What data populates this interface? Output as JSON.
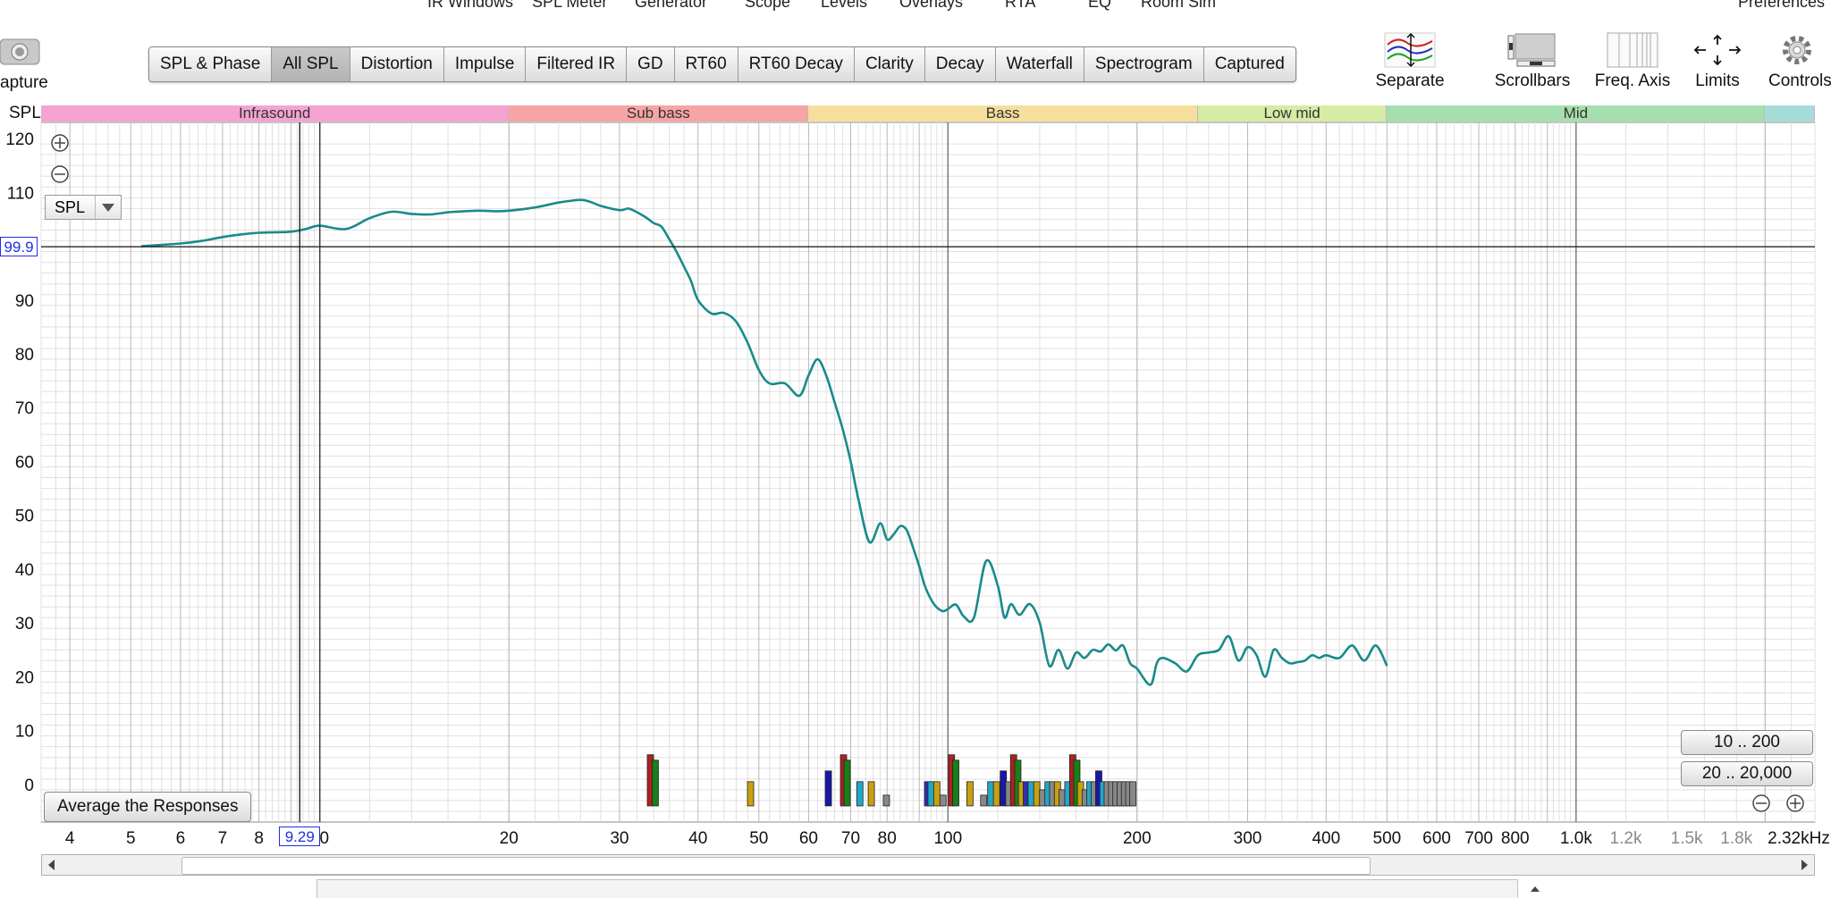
{
  "menu": {
    "items": [
      "IR Windows",
      "SPL Meter",
      "Generator",
      "Scope",
      "Levels",
      "Overlays",
      "RTA",
      "EQ",
      "Room Sim",
      "Preferences"
    ]
  },
  "capture": {
    "label": "apture"
  },
  "tabs": [
    {
      "label": "SPL & Phase",
      "active": false
    },
    {
      "label": "All SPL",
      "active": true
    },
    {
      "label": "Distortion",
      "active": false
    },
    {
      "label": "Impulse",
      "active": false
    },
    {
      "label": "Filtered IR",
      "active": false
    },
    {
      "label": "GD",
      "active": false
    },
    {
      "label": "RT60",
      "active": false
    },
    {
      "label": "RT60 Decay",
      "active": false
    },
    {
      "label": "Clarity",
      "active": false
    },
    {
      "label": "Decay",
      "active": false
    },
    {
      "label": "Waterfall",
      "active": false
    },
    {
      "label": "Spectrogram",
      "active": false
    },
    {
      "label": "Captured",
      "active": false
    }
  ],
  "toolbar": {
    "separate_label": "Separate",
    "scrollbars_label": "Scrollbars",
    "freq_axis_label": "Freq. Axis",
    "limits_label": "Limits",
    "controls_label": "Controls"
  },
  "graph": {
    "y_axis_title": "SPL",
    "selector_value": "SPL",
    "average_button_label": "Average the Responses",
    "range_buttons": [
      "10 .. 200",
      "20 .. 20,000"
    ],
    "cursor_y_readout": "99.9",
    "cursor_x_readout": "9.29",
    "bands": [
      {
        "label": "Infrasound",
        "from": 3.6,
        "to": 20,
        "color": "#f4a3d2"
      },
      {
        "label": "Sub bass",
        "from": 20,
        "to": 60,
        "color": "#f6a4a4"
      },
      {
        "label": "Bass",
        "from": 60,
        "to": 250,
        "color": "#f6df9c"
      },
      {
        "label": "Low mid",
        "from": 250,
        "to": 500,
        "color": "#d6eba3"
      },
      {
        "label": "Mid",
        "from": 500,
        "to": 2000,
        "color": "#a6dfae"
      },
      {
        "label": "",
        "from": 2000,
        "to": 2400,
        "color": "#a6dcd8"
      }
    ],
    "x_tick_labels": [
      {
        "f": 4,
        "text": "4"
      },
      {
        "f": 5,
        "text": "5"
      },
      {
        "f": 6,
        "text": "6"
      },
      {
        "f": 7,
        "text": "7"
      },
      {
        "f": 8,
        "text": "8"
      },
      {
        "f": 10,
        "text": "0"
      },
      {
        "f": 20,
        "text": "20"
      },
      {
        "f": 30,
        "text": "30"
      },
      {
        "f": 40,
        "text": "40"
      },
      {
        "f": 50,
        "text": "50"
      },
      {
        "f": 60,
        "text": "60"
      },
      {
        "f": 70,
        "text": "70"
      },
      {
        "f": 80,
        "text": "80"
      },
      {
        "f": 100,
        "text": "100"
      },
      {
        "f": 200,
        "text": "200"
      },
      {
        "f": 300,
        "text": "300"
      },
      {
        "f": 400,
        "text": "400"
      },
      {
        "f": 500,
        "text": "500"
      },
      {
        "f": 600,
        "text": "600"
      },
      {
        "f": 700,
        "text": "700"
      },
      {
        "f": 800,
        "text": "800"
      },
      {
        "f": 1000,
        "text": "1.0k"
      },
      {
        "f": 1200,
        "text": "1.2k",
        "grey": true
      },
      {
        "f": 1500,
        "text": "1.5k",
        "grey": true
      },
      {
        "f": 1800,
        "text": "1.8k",
        "grey": true
      },
      {
        "f": 2320,
        "text": "2.32kHz"
      }
    ],
    "y_tick_labels": [
      "120",
      "110",
      "90",
      "80",
      "70",
      "60",
      "50",
      "40",
      "30",
      "20",
      "10",
      "0"
    ]
  },
  "chart_data": {
    "type": "line",
    "xscale": "log",
    "xlim": [
      3.6,
      2400
    ],
    "ylim": [
      -7,
      123
    ],
    "ylabel": "SPL",
    "grid": true,
    "cursor": {
      "x": 9.29,
      "y": 99.9
    },
    "series": [
      {
        "color": "#1a8a8a",
        "x": [
          5.2,
          6,
          6.5,
          7,
          7.5,
          8,
          8.5,
          9,
          9.5,
          10,
          11,
          12,
          13,
          14,
          15,
          16,
          17,
          18,
          19,
          20,
          22,
          24,
          26,
          27,
          28,
          30,
          31,
          32,
          33,
          34,
          35,
          36,
          37,
          38,
          39,
          40,
          42,
          44,
          46,
          48,
          50,
          52,
          55,
          58,
          60,
          62,
          64,
          66,
          68,
          70,
          72,
          75,
          78,
          80,
          82,
          84,
          86,
          88,
          90,
          92,
          95,
          98,
          100,
          103,
          106,
          110,
          115,
          120,
          123,
          126,
          130,
          135,
          140,
          145,
          150,
          155,
          160,
          165,
          170,
          175,
          180,
          185,
          190,
          195,
          200,
          210,
          215,
          220,
          230,
          240,
          250,
          260,
          270,
          280,
          290,
          300,
          310,
          320,
          330,
          340,
          350,
          360,
          370,
          380,
          390,
          400,
          420,
          440,
          460,
          480,
          500
        ],
        "y": [
          100,
          100.5,
          101,
          101.7,
          102.2,
          102.5,
          102.6,
          102.7,
          103.2,
          103.8,
          103.2,
          105.2,
          106.4,
          106,
          105.9,
          106.3,
          106.5,
          106.6,
          106.5,
          106.6,
          107.2,
          108.1,
          108.6,
          108.2,
          107.5,
          106.7,
          107,
          106.3,
          105.4,
          104.3,
          103.6,
          101.3,
          98.9,
          96.2,
          93.5,
          90,
          87.5,
          87.6,
          86,
          82,
          77,
          74.5,
          74.5,
          72.2,
          76,
          79,
          76,
          71,
          66,
          60,
          53,
          45,
          48.5,
          45.5,
          46.5,
          48,
          47.2,
          44,
          40.5,
          36.7,
          33.5,
          32.2,
          32.6,
          33.4,
          31.2,
          31,
          41.5,
          37,
          31,
          33.5,
          31.5,
          33.5,
          30,
          22,
          25,
          21.5,
          24.5,
          23.5,
          25,
          24.7,
          26,
          24.9,
          25.8,
          22.5,
          21.5,
          18.5,
          22.5,
          23.5,
          22.5,
          21,
          24,
          24.5,
          25,
          27.5,
          23,
          25.5,
          24,
          20,
          25,
          23.5,
          22.5,
          22.7,
          23,
          24,
          23.5,
          24,
          23.5,
          25.8,
          23,
          25.8,
          22
        ]
      }
    ],
    "bars": {
      "description_units": "frequency Hz, height dB",
      "items": [
        {
          "f": 33.6,
          "h": 5.5,
          "c": "#b02020"
        },
        {
          "f": 34.2,
          "h": 4.5,
          "c": "#188018"
        },
        {
          "f": 48.5,
          "h": 0.5,
          "c": "#c8a010"
        },
        {
          "f": 64.5,
          "h": 2.5,
          "c": "#1818a8"
        },
        {
          "f": 68.2,
          "h": 5.5,
          "c": "#b02020"
        },
        {
          "f": 69.1,
          "h": 4.5,
          "c": "#188018"
        },
        {
          "f": 72.4,
          "h": 0.5,
          "c": "#20a8c8"
        },
        {
          "f": 75.5,
          "h": 0.5,
          "c": "#c8a010"
        },
        {
          "f": 79.8,
          "h": -2,
          "c": "#888888"
        },
        {
          "f": 92.8,
          "h": 0.5,
          "c": "#3030b0"
        },
        {
          "f": 94,
          "h": 0.5,
          "c": "#20a8c8"
        },
        {
          "f": 96,
          "h": 0.5,
          "c": "#c8a010"
        },
        {
          "f": 98.2,
          "h": -2,
          "c": "#888888"
        },
        {
          "f": 101.3,
          "h": 5.5,
          "c": "#b02020"
        },
        {
          "f": 102.9,
          "h": 4.5,
          "c": "#188018"
        },
        {
          "f": 108.4,
          "h": 0.5,
          "c": "#c8a010"
        },
        {
          "f": 114,
          "h": -2,
          "c": "#888888"
        },
        {
          "f": 117,
          "h": 0.5,
          "c": "#20a8c8"
        },
        {
          "f": 119.5,
          "h": 0.5,
          "c": "#c8a010"
        },
        {
          "f": 122.5,
          "h": 2.5,
          "c": "#1818a8"
        },
        {
          "f": 125,
          "h": 0.5,
          "c": "#888888"
        },
        {
          "f": 127.2,
          "h": 5.5,
          "c": "#b02020"
        },
        {
          "f": 129.2,
          "h": 4.5,
          "c": "#188018"
        },
        {
          "f": 131,
          "h": 0.5,
          "c": "#c8a010"
        },
        {
          "f": 133.3,
          "h": 0.5,
          "c": "#3030b0"
        },
        {
          "f": 135.7,
          "h": 0.5,
          "c": "#20a8c8"
        },
        {
          "f": 138.5,
          "h": 0.5,
          "c": "#c8a010"
        },
        {
          "f": 141.5,
          "h": -1,
          "c": "#888888"
        },
        {
          "f": 144.3,
          "h": 0.5,
          "c": "#20a8c8"
        },
        {
          "f": 146.8,
          "h": 0.5,
          "c": "#888888"
        },
        {
          "f": 149.4,
          "h": 0.5,
          "c": "#c8a010"
        },
        {
          "f": 152,
          "h": -1,
          "c": "#888888"
        },
        {
          "f": 155.2,
          "h": 0.5,
          "c": "#20a8c8"
        },
        {
          "f": 158,
          "h": 5.5,
          "c": "#b02020"
        },
        {
          "f": 160.4,
          "h": 4.5,
          "c": "#188018"
        },
        {
          "f": 162.6,
          "h": 0.5,
          "c": "#c8a010"
        },
        {
          "f": 165.4,
          "h": -1,
          "c": "#888888"
        },
        {
          "f": 168.2,
          "h": 0.5,
          "c": "#20a8c8"
        },
        {
          "f": 171,
          "h": 0.5,
          "c": "#888888"
        },
        {
          "f": 173.8,
          "h": 2.5,
          "c": "#1818a8"
        },
        {
          "f": 176.5,
          "h": 0.5,
          "c": "#20a8c8"
        },
        {
          "f": 179.3,
          "h": 0.5,
          "c": "#888888"
        },
        {
          "f": 182.2,
          "h": 0.5,
          "c": "#888888"
        },
        {
          "f": 185.1,
          "h": 0.5,
          "c": "#888888"
        },
        {
          "f": 188,
          "h": 0.5,
          "c": "#888888"
        },
        {
          "f": 191,
          "h": 0.5,
          "c": "#888888"
        },
        {
          "f": 194,
          "h": 0.5,
          "c": "#888888"
        },
        {
          "f": 197,
          "h": 0.5,
          "c": "#888888"
        }
      ]
    }
  },
  "colors": {
    "curve": "#1a8a8a",
    "cursor_readout": "#2030e0",
    "grid_major": "#b9b9b9",
    "grid_minor": "#e0e0e0"
  }
}
